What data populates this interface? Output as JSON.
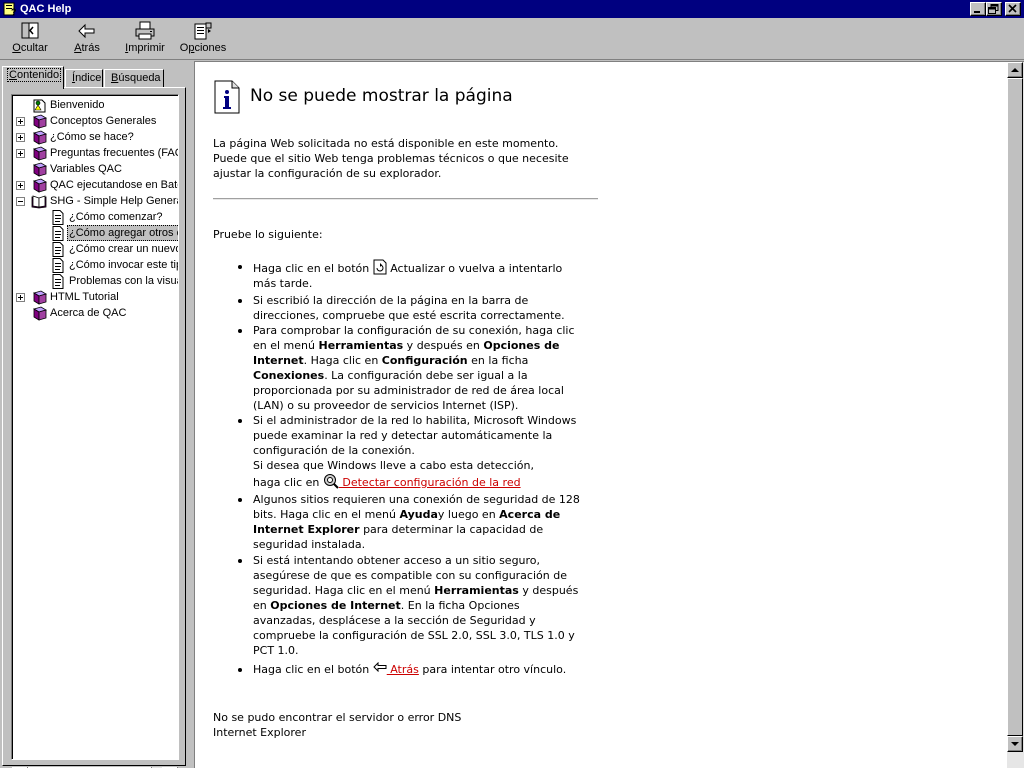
{
  "window": {
    "title": "QAC Help"
  },
  "toolbar": {
    "hide": {
      "pre": "",
      "ul": "O",
      "post": "cultar"
    },
    "back": {
      "pre": "",
      "ul": "A",
      "post": "trás"
    },
    "print": {
      "pre": "",
      "ul": "I",
      "post": "mprimir"
    },
    "options": {
      "pre": "O",
      "ul": "p",
      "post": "ciones"
    }
  },
  "tabs": [
    {
      "pre": "",
      "ul": "C",
      "post": "ontenido"
    },
    {
      "pre": "",
      "ul": "Í",
      "post": "ndice"
    },
    {
      "pre": "",
      "ul": "B",
      "post": "úsqueda"
    }
  ],
  "tree": [
    {
      "label": "Bienvenido",
      "expander": "none",
      "icon": "page-person-icon",
      "level": 0
    },
    {
      "label": "Conceptos Generales",
      "expander": "plus",
      "icon": "book-closed-icon",
      "level": 0
    },
    {
      "label": "¿Cómo se hace?",
      "expander": "plus",
      "icon": "book-closed-icon",
      "level": 0
    },
    {
      "label": "Preguntas frecuentes (FAQ)",
      "expander": "plus",
      "icon": "book-closed-icon",
      "level": 0
    },
    {
      "label": "Variables QAC",
      "expander": "none",
      "icon": "book-closed-icon",
      "level": 0
    },
    {
      "label": "QAC ejecutandose en Batch",
      "expander": "plus",
      "icon": "book-closed-icon",
      "level": 0
    },
    {
      "label": "SHG - Simple Help Generator",
      "expander": "minus",
      "icon": "book-open-icon",
      "level": 0
    },
    {
      "label": "¿Cómo comenzar?",
      "expander": "none",
      "icon": "page-icon",
      "level": 1
    },
    {
      "label": "¿Cómo agregar otros contenidos?",
      "expander": "none",
      "icon": "page-icon",
      "level": 1,
      "selected": true
    },
    {
      "label": "¿Cómo crear un nuevo tema?",
      "expander": "none",
      "icon": "page-icon",
      "level": 1
    },
    {
      "label": "¿Cómo invocar este tipo de ayuda?",
      "expander": "none",
      "icon": "page-icon",
      "level": 1
    },
    {
      "label": "Problemas con la visualización",
      "expander": "none",
      "icon": "page-icon",
      "level": 1
    },
    {
      "label": "HTML Tutorial",
      "expander": "plus",
      "icon": "book-closed-icon",
      "level": 0
    },
    {
      "label": "Acerca de QAC",
      "expander": "none",
      "icon": "book-closed-icon",
      "level": 0
    }
  ],
  "page": {
    "title": "No se puede mostrar la página",
    "intro": [
      "La página Web solicitada no está disponible en este momento.",
      "Puede que el sitio Web tenga problemas técnicos o que necesite",
      "ajustar la configuración de su explorador."
    ],
    "try_label": "Pruebe lo siguiente:",
    "b1": {
      "a": "Haga clic en el botón ",
      "b": " Actualizar o vuelva a intentarlo",
      "c": "más tarde."
    },
    "b2": {
      "a": "Si escribió la dirección de la página en la barra de",
      "b": "direcciones, compruebe que esté escrita correctamente."
    },
    "b3": {
      "a": "Para comprobar la configuración de su conexión, haga clic",
      "b1": "en el menú ",
      "b2": "Herramientas",
      "b3": " y después en ",
      "b4": "Opciones de",
      "c1": "Internet",
      "c2": ". Haga clic en ",
      "c3": "Configuración",
      "c4": " en la ficha",
      "d1": "Conexiones",
      "d2": ". La configuración debe ser igual a la",
      "e": "proporcionada por su administrador de red de área local",
      "f": "(LAN) o su proveedor de servicios Internet (ISP)."
    },
    "b4": {
      "a": "Si el administrador de la red lo habilita, Microsoft Windows",
      "b": "puede examinar la red y detectar automáticamente la",
      "c": "configuración de la conexión.",
      "d": "Si desea que Windows lleve a cabo esta detección,",
      "e": "haga clic en ",
      "link": " Detectar configuración de la red"
    },
    "b5": {
      "a": "Algunos sitios requieren una conexión de seguridad de 128",
      "b1": "bits. Haga clic en el menú ",
      "b2": "Ayuda",
      "b3": "y luego en ",
      "b4": "Acerca de",
      "c1": "Internet Explorer",
      "c2": " para determinar la capacidad de",
      "d": "seguridad instalada."
    },
    "b6": {
      "a": "Si está intentando obtener acceso a un sitio seguro,",
      "b": "asegúrese de que es compatible con su configuración de",
      "c1": "seguridad. Haga clic en el menú ",
      "c2": "Herramientas",
      "c3": " y después",
      "d1": "en ",
      "d2": "Opciones de Internet",
      "d3": ". En la ficha Opciones",
      "e": "avanzadas, desplácese a la sección de Seguridad y",
      "f": "compruebe la configuración de SSL 2.0, SSL 3.0, TLS 1.0 y",
      "g": "PCT 1.0."
    },
    "b7": {
      "a": "Haga clic en el botón ",
      "link": " Atrás",
      "b": " para intentar otro vínculo."
    },
    "footer": [
      "No se pudo encontrar el servidor o error DNS",
      "Internet Explorer"
    ]
  }
}
